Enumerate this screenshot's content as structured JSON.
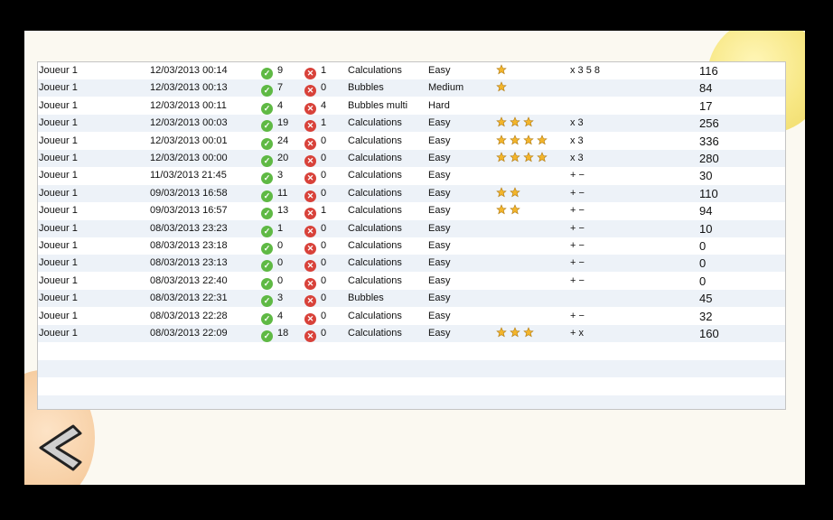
{
  "rows": [
    {
      "player": "Joueur 1",
      "date": "12/03/2013 00:14",
      "correct": "9",
      "wrong": "1",
      "game": "Calculations",
      "level": "Easy",
      "stars": 1,
      "ops": "x 3 5 8",
      "score": "116"
    },
    {
      "player": "Joueur 1",
      "date": "12/03/2013 00:13",
      "correct": "7",
      "wrong": "0",
      "game": "Bubbles",
      "level": "Medium",
      "stars": 1,
      "ops": "",
      "score": "84"
    },
    {
      "player": "Joueur 1",
      "date": "12/03/2013 00:11",
      "correct": "4",
      "wrong": "4",
      "game": "Bubbles multi",
      "level": "Hard",
      "stars": 0,
      "ops": "",
      "score": "17"
    },
    {
      "player": "Joueur 1",
      "date": "12/03/2013 00:03",
      "correct": "19",
      "wrong": "1",
      "game": "Calculations",
      "level": "Easy",
      "stars": 3,
      "ops": "x 3",
      "score": "256"
    },
    {
      "player": "Joueur 1",
      "date": "12/03/2013 00:01",
      "correct": "24",
      "wrong": "0",
      "game": "Calculations",
      "level": "Easy",
      "stars": 4,
      "ops": "x 3",
      "score": "336"
    },
    {
      "player": "Joueur 1",
      "date": "12/03/2013 00:00",
      "correct": "20",
      "wrong": "0",
      "game": "Calculations",
      "level": "Easy",
      "stars": 4,
      "ops": "x 3",
      "score": "280"
    },
    {
      "player": "Joueur 1",
      "date": "11/03/2013 21:45",
      "correct": "3",
      "wrong": "0",
      "game": "Calculations",
      "level": "Easy",
      "stars": 0,
      "ops": "+ −",
      "score": "30"
    },
    {
      "player": "Joueur 1",
      "date": "09/03/2013 16:58",
      "correct": "11",
      "wrong": "0",
      "game": "Calculations",
      "level": "Easy",
      "stars": 2,
      "ops": "+ −",
      "score": "110"
    },
    {
      "player": "Joueur 1",
      "date": "09/03/2013 16:57",
      "correct": "13",
      "wrong": "1",
      "game": "Calculations",
      "level": "Easy",
      "stars": 2,
      "ops": "+ −",
      "score": "94"
    },
    {
      "player": "Joueur 1",
      "date": "08/03/2013 23:23",
      "correct": "1",
      "wrong": "0",
      "game": "Calculations",
      "level": "Easy",
      "stars": 0,
      "ops": "+ −",
      "score": "10"
    },
    {
      "player": "Joueur 1",
      "date": "08/03/2013 23:18",
      "correct": "0",
      "wrong": "0",
      "game": "Calculations",
      "level": "Easy",
      "stars": 0,
      "ops": "+ −",
      "score": "0"
    },
    {
      "player": "Joueur 1",
      "date": "08/03/2013 23:13",
      "correct": "0",
      "wrong": "0",
      "game": "Calculations",
      "level": "Easy",
      "stars": 0,
      "ops": "+ −",
      "score": "0"
    },
    {
      "player": "Joueur 1",
      "date": "08/03/2013 22:40",
      "correct": "0",
      "wrong": "0",
      "game": "Calculations",
      "level": "Easy",
      "stars": 0,
      "ops": "+ −",
      "score": "0"
    },
    {
      "player": "Joueur 1",
      "date": "08/03/2013 22:31",
      "correct": "3",
      "wrong": "0",
      "game": "Bubbles",
      "level": "Easy",
      "stars": 0,
      "ops": "",
      "score": "45"
    },
    {
      "player": "Joueur 1",
      "date": "08/03/2013 22:28",
      "correct": "4",
      "wrong": "0",
      "game": "Calculations",
      "level": "Easy",
      "stars": 0,
      "ops": "+ −",
      "score": "32"
    },
    {
      "player": "Joueur 1",
      "date": "08/03/2013 22:09",
      "correct": "18",
      "wrong": "0",
      "game": "Calculations",
      "level": "Easy",
      "stars": 3,
      "ops": "+ x",
      "score": "160"
    }
  ],
  "icons": {
    "correct": "check-circle-icon",
    "wrong": "x-circle-icon",
    "star": "star-icon",
    "back": "back-arrow-icon"
  },
  "colors": {
    "row_alt": "#edf2f8",
    "correct": "#5fb944",
    "wrong": "#d8423a",
    "star": "#f3b52b",
    "background": "#fbf9f1"
  }
}
